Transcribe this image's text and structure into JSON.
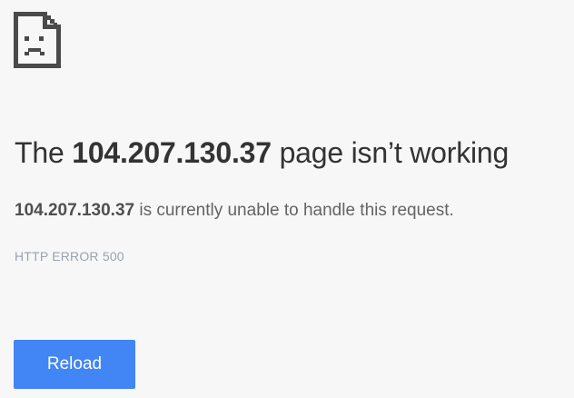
{
  "error_page": {
    "icon": "sad-page-icon",
    "headline": {
      "prefix": "The ",
      "host": "104.207.130.37",
      "suffix": " page isn’t working"
    },
    "message": {
      "host": "104.207.130.37",
      "text": " is currently unable to handle this request."
    },
    "error_code": "HTTP ERROR 500",
    "reload_label": "Reload"
  },
  "colors": {
    "background": "#f7f7f7",
    "button": "#4285f4",
    "headline": "#333333",
    "error_code": "#9aa2ad"
  }
}
